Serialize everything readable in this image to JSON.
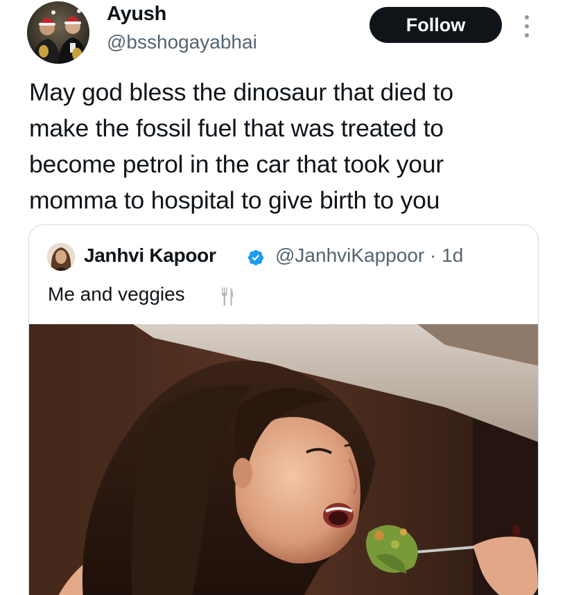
{
  "author": {
    "name": "Ayush",
    "handle": "@bsshogayabhai",
    "avatar_icon": "profile-photo-two-men-santa-hats"
  },
  "follow_label": "Follow",
  "more_icon": "more-vertical-icon",
  "tweet": {
    "lines": [
      "May god bless the dinosaur that died to",
      "make the fossil fuel that was treated to",
      "become petrol in the car that took your",
      "momma to hospital to give birth to you"
    ]
  },
  "quoted": {
    "name": "Janhvi Kapoor",
    "verified_icon": "verified-badge-icon",
    "handle": "@JanhviKappoor",
    "separator": "·",
    "time": "1d",
    "text": "Me and veggies",
    "emoji_icon": "fork-and-knife-icon",
    "media_alt": "woman eating salad from fork"
  },
  "colors": {
    "text": "#0f1419",
    "secondary": "#536471",
    "follow_bg": "#0f1419",
    "follow_text": "#ffffff",
    "verified": "#1d9bf0",
    "border": "#cfd9de"
  }
}
